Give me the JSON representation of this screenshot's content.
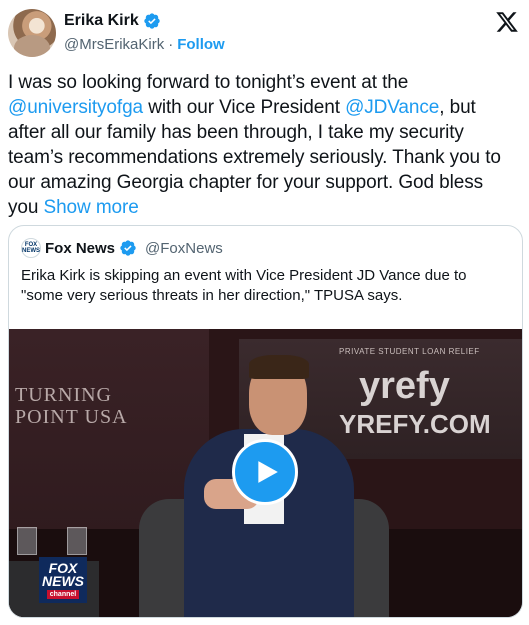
{
  "author": {
    "name": "Erika Kirk",
    "handle": "@MrsErikaKirk",
    "separator": "·",
    "follow_label": "Follow"
  },
  "tweet": {
    "line1": "I was so looking forward to tonight’s event at the",
    "line2_mention1": "@universityofga",
    "line2_mid": " with our Vice President ",
    "line2_mention2": "@JDVance",
    "line2_end": ", but",
    "line3": "after all our family has been through, I take my security",
    "line4": "team’s recommendations extremely seriously. Thank you to",
    "line5": "our amazing Georgia chapter for your support. God bless",
    "line6": "you ",
    "show_more": "Show more"
  },
  "quote": {
    "avatar_text": "FOX NEWS",
    "name": "Fox News",
    "handle": "@FoxNews",
    "text": "Erika Kirk is skipping an event with Vice President JD Vance due to \"some very serious threats in her direction,\" TPUSA says."
  },
  "video": {
    "banner_line1": "TURNING",
    "banner_line2": "POINT USA",
    "screen_small": "PRIVATE STUDENT LOAN RELIEF",
    "screen_brand": "yrefy",
    "screen_url": "YREFY.COM",
    "fox_line1": "FOX",
    "fox_line2": "NEWS",
    "fox_channel": "channel"
  },
  "colors": {
    "accent": "#1d9bf0",
    "text": "#0f1419",
    "muted": "#536471",
    "border": "#cfd9de"
  },
  "icons": {
    "verified": "verified-badge-icon",
    "x_logo": "x-logo-icon",
    "play": "play-icon"
  }
}
